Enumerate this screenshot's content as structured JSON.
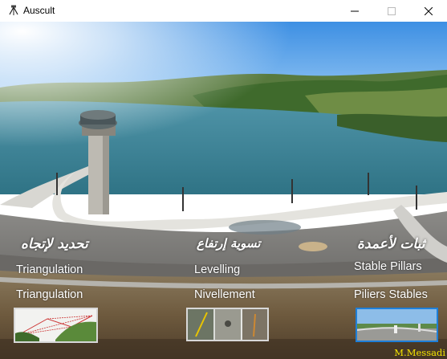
{
  "window": {
    "title": "Auscult",
    "minimize_icon": "minimize-icon",
    "maximize_icon": "maximize-icon",
    "close_icon": "close-icon"
  },
  "columns": [
    {
      "arabic": "تحديد لإتجاه",
      "english": "Triangulation",
      "french": "Triangulation",
      "thumb_icon": "triangulation-thumbnail"
    },
    {
      "arabic": "تسوية إرتفاع",
      "english": "Levelling",
      "french": "Nivellement",
      "thumb_icon": "levelling-thumbnail"
    },
    {
      "arabic": "ثبات لأعمدة",
      "english": "Stable Pillars",
      "french": "Piliers Stables",
      "thumb_icon": "pillars-thumbnail"
    }
  ],
  "credit": "M.Messadi",
  "colors": {
    "selected_border": "#1e7fd8",
    "credit": "#f5e400",
    "label": "#ffffff"
  }
}
